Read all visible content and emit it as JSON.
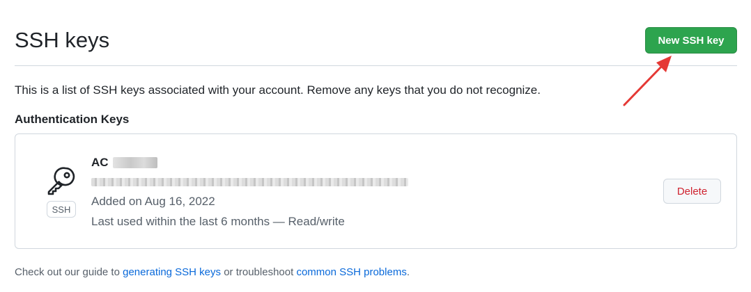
{
  "header": {
    "title": "SSH keys",
    "new_key_label": "New SSH key"
  },
  "intro_text": "This is a list of SSH keys associated with your account. Remove any keys that you do not recognize.",
  "section": {
    "title": "Authentication Keys"
  },
  "key": {
    "name_visible": "AC",
    "type_badge": "SSH",
    "added": "Added on Aug 16, 2022",
    "last_used": "Last used within the last 6 months — Read/write",
    "delete_label": "Delete"
  },
  "footer": {
    "prefix": "Check out our guide to ",
    "link1": "generating SSH keys",
    "middle": " or troubleshoot ",
    "link2": "common SSH problems",
    "suffix": "."
  },
  "colors": {
    "primary_button": "#2da44e",
    "danger_text": "#cf222e",
    "link": "#0969da",
    "annotation_arrow": "#e53935"
  },
  "icons": {
    "key": "key-icon"
  }
}
